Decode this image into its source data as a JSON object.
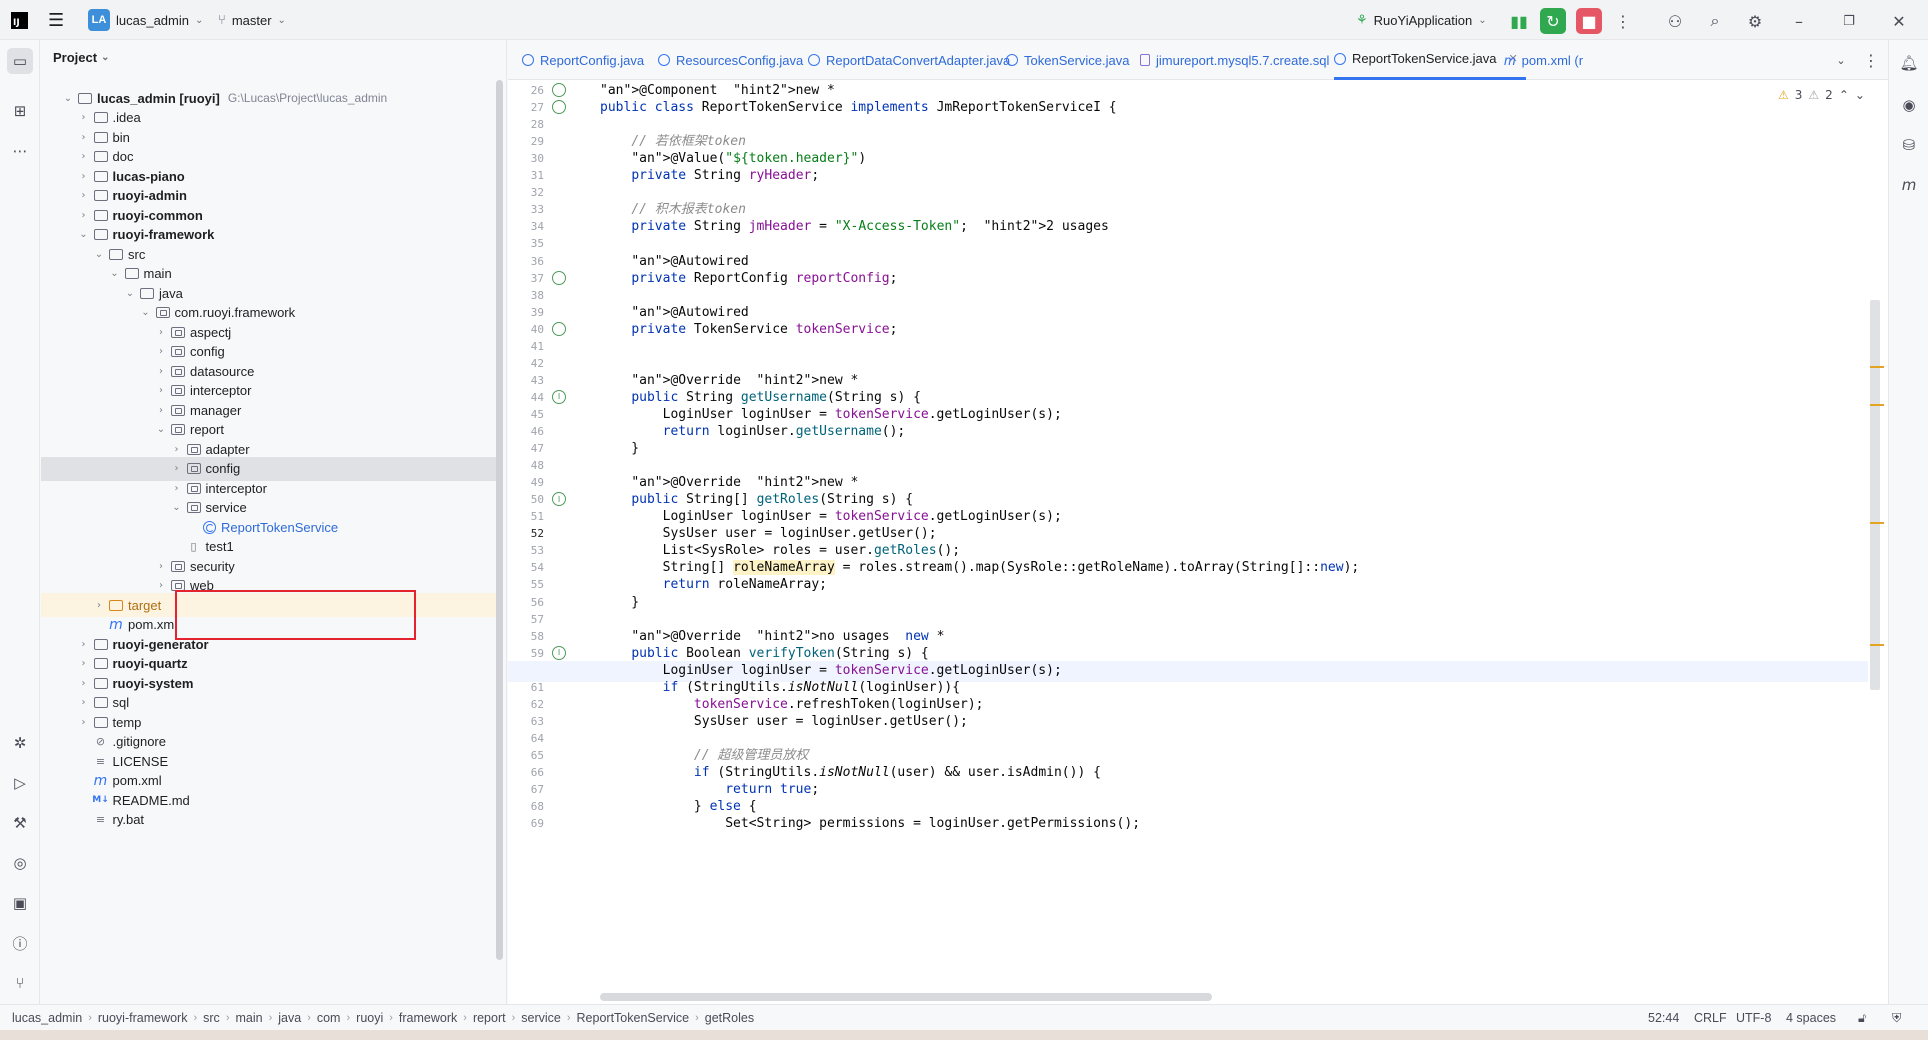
{
  "titlebar": {
    "project_badge": "LA",
    "project_name": "lucas_admin",
    "branch": "master",
    "run_config": "RuoYiApplication"
  },
  "project_panel": {
    "title": "Project",
    "root_name": "lucas_admin [ruoyi]",
    "root_path": "G:\\Lucas\\Project\\lucas_admin",
    "items": [
      {
        "label": "lucas_admin [ruoyi]",
        "depth": 0,
        "type": "module",
        "expanded": true
      },
      {
        "label": ".idea",
        "depth": 1,
        "type": "folder"
      },
      {
        "label": "bin",
        "depth": 1,
        "type": "folder"
      },
      {
        "label": "doc",
        "depth": 1,
        "type": "folder"
      },
      {
        "label": "lucas-piano",
        "depth": 1,
        "type": "module"
      },
      {
        "label": "ruoyi-admin",
        "depth": 1,
        "type": "module"
      },
      {
        "label": "ruoyi-common",
        "depth": 1,
        "type": "module"
      },
      {
        "label": "ruoyi-framework",
        "depth": 1,
        "type": "module",
        "expanded": true
      },
      {
        "label": "src",
        "depth": 2,
        "type": "folder",
        "expanded": true
      },
      {
        "label": "main",
        "depth": 3,
        "type": "folder",
        "expanded": true
      },
      {
        "label": "java",
        "depth": 4,
        "type": "folder",
        "expanded": true
      },
      {
        "label": "com.ruoyi.framework",
        "depth": 5,
        "type": "package",
        "expanded": true
      },
      {
        "label": "aspectj",
        "depth": 6,
        "type": "package"
      },
      {
        "label": "config",
        "depth": 6,
        "type": "package"
      },
      {
        "label": "datasource",
        "depth": 6,
        "type": "package"
      },
      {
        "label": "interceptor",
        "depth": 6,
        "type": "package"
      },
      {
        "label": "manager",
        "depth": 6,
        "type": "package"
      },
      {
        "label": "report",
        "depth": 6,
        "type": "package",
        "expanded": true
      },
      {
        "label": "adapter",
        "depth": 7,
        "type": "package"
      },
      {
        "label": "config",
        "depth": 7,
        "type": "package",
        "selected": true
      },
      {
        "label": "interceptor",
        "depth": 7,
        "type": "package"
      },
      {
        "label": "service",
        "depth": 7,
        "type": "package",
        "expanded": true
      },
      {
        "label": "ReportTokenService",
        "depth": 8,
        "type": "class"
      },
      {
        "label": "test1",
        "depth": 7,
        "type": "file"
      },
      {
        "label": "security",
        "depth": 6,
        "type": "package"
      },
      {
        "label": "web",
        "depth": 6,
        "type": "package"
      },
      {
        "label": "target",
        "depth": 2,
        "type": "target"
      },
      {
        "label": "pom.xml",
        "depth": 2,
        "type": "maven"
      },
      {
        "label": "ruoyi-generator",
        "depth": 1,
        "type": "module"
      },
      {
        "label": "ruoyi-quartz",
        "depth": 1,
        "type": "module"
      },
      {
        "label": "ruoyi-system",
        "depth": 1,
        "type": "module"
      },
      {
        "label": "sql",
        "depth": 1,
        "type": "folder"
      },
      {
        "label": "temp",
        "depth": 1,
        "type": "folder"
      },
      {
        "label": ".gitignore",
        "depth": 1,
        "type": "ignore"
      },
      {
        "label": "LICENSE",
        "depth": 1,
        "type": "text"
      },
      {
        "label": "pom.xml",
        "depth": 1,
        "type": "maven"
      },
      {
        "label": "README.md",
        "depth": 1,
        "type": "md"
      },
      {
        "label": "ry.bat",
        "depth": 1,
        "type": "text"
      }
    ]
  },
  "tabs": [
    {
      "label": "ReportConfig.java",
      "icon": "class-icon"
    },
    {
      "label": "ResourcesConfig.java",
      "icon": "class-icon"
    },
    {
      "label": "ReportDataConvertAdapter.java",
      "icon": "class-icon"
    },
    {
      "label": "TokenService.java",
      "icon": "class-icon"
    },
    {
      "label": "jimureport.mysql5.7.create.sql",
      "icon": "sql-icon"
    },
    {
      "label": "ReportTokenService.java",
      "icon": "class-icon",
      "active": true
    },
    {
      "label": "pom.xml (r",
      "icon": "maven-icon"
    }
  ],
  "inspections": {
    "warnings": "3",
    "weak_warnings": "2"
  },
  "editor": {
    "first_line": 26,
    "current_line": 52,
    "lines": [
      "@Component  new *",
      "public class ReportTokenService implements JmReportTokenServiceI {",
      "",
      "    // 若依框架token",
      "    @Value(\"${token.header}\")",
      "    private String ryHeader;",
      "",
      "    // 积木报表token",
      "    private String jmHeader = \"X-Access-Token\";  2 usages",
      "",
      "    @Autowired",
      "    private ReportConfig reportConfig;",
      "",
      "    @Autowired",
      "    private TokenService tokenService;",
      "",
      "",
      "    @Override  new *",
      "    public String getUsername(String s) {",
      "        LoginUser loginUser = tokenService.getLoginUser(s);",
      "        return loginUser.getUsername();",
      "    }",
      "",
      "    @Override  new *",
      "    public String[] getRoles(String s) {",
      "        LoginUser loginUser = tokenService.getLoginUser(s);",
      "        SysUser user = loginUser.getUser();",
      "        List<SysRole> roles = user.getRoles();",
      "        String[] roleNameArray = roles.stream().map(SysRole::getRoleName).toArray(String[]::new);",
      "        return roleNameArray;",
      "    }",
      "",
      "    @Override  no usages  new *",
      "    public Boolean verifyToken(String s) {",
      "        LoginUser loginUser = tokenService.getLoginUser(s);",
      "        if (StringUtils.isNotNull(loginUser)){",
      "            tokenService.refreshToken(loginUser);",
      "            SysUser user = loginUser.getUser();",
      "",
      "            // 超级管理员放权",
      "            if (StringUtils.isNotNull(user) && user.isAdmin()) {",
      "                return true;",
      "            } else {",
      "                Set<String> permissions = loginUser.getPermissions();"
    ]
  },
  "statusbar": {
    "breadcrumbs": [
      "lucas_admin",
      "ruoyi-framework",
      "src",
      "main",
      "java",
      "com",
      "ruoyi",
      "framework",
      "report",
      "service",
      "ReportTokenService",
      "getRoles"
    ],
    "position": "52:44",
    "line_separator": "CRLF",
    "encoding": "UTF-8",
    "indent": "4 spaces"
  }
}
